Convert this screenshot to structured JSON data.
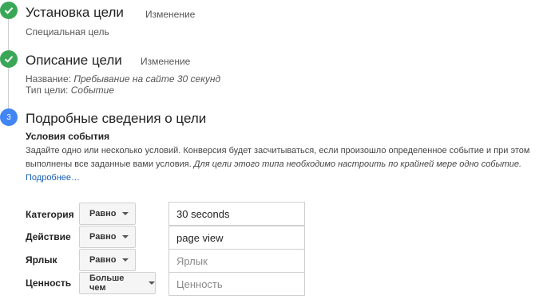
{
  "steps": [
    {
      "title": "Установка цели",
      "edit": "Изменение",
      "subtitle": "Специальная цель"
    },
    {
      "title": "Описание цели",
      "edit": "Изменение",
      "name_label": "Название:",
      "name_value": "Пребывание на сайте 30 секунд",
      "type_label": "Тип цели:",
      "type_value": "Событие"
    },
    {
      "number": "3",
      "title": "Подробные сведения о цели"
    }
  ],
  "conditions": {
    "title": "Условия события",
    "description_main": "Задайте одно или несколько условий. Конверсия будет засчитываться, если произошло определенное событие и при этом выполнены все заданные вами условия.",
    "description_italic": "Для цели этого типа необходимо настроить по крайней мере одно событие.",
    "more_link": "Подробнее…",
    "rows": [
      {
        "label": "Категория",
        "operator": "Равно",
        "value": "30 seconds",
        "placeholder": ""
      },
      {
        "label": "Действие",
        "operator": "Равно",
        "value": "page view",
        "placeholder": ""
      },
      {
        "label": "Ярлык",
        "operator": "Равно",
        "value": "",
        "placeholder": "Ярлык"
      },
      {
        "label": "Ценность",
        "operator": "Больше чем",
        "value": "",
        "placeholder": "Ценность"
      }
    ]
  },
  "colors": {
    "done": "#3aa757",
    "active": "#4285f4",
    "link": "#1a5fb4"
  }
}
